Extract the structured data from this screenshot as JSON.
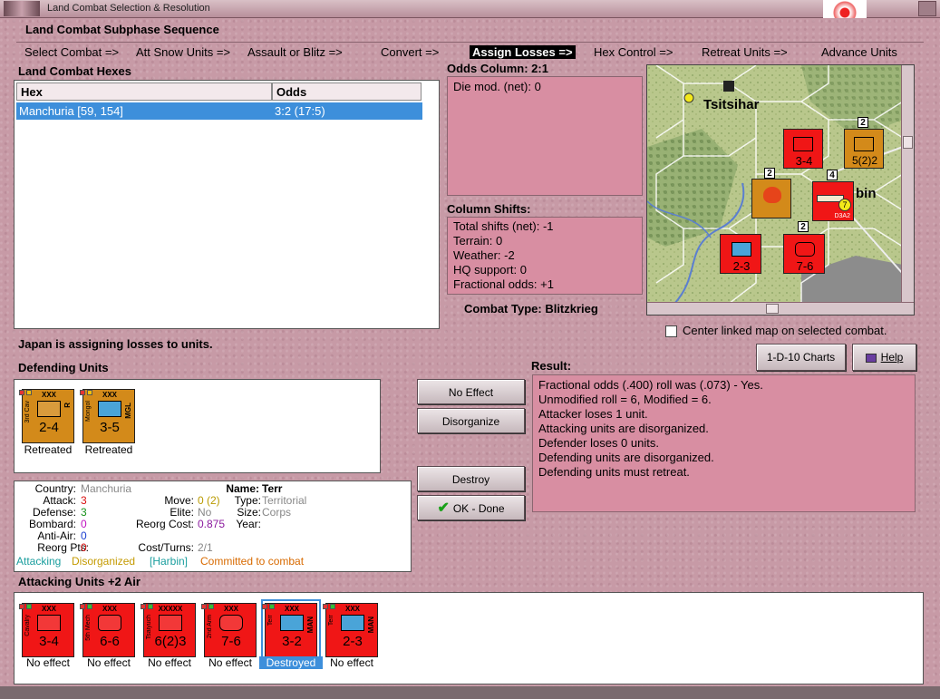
{
  "window": {
    "title": "Land Combat Selection & Resolution"
  },
  "subphase": {
    "header": "Land Combat Subphase Sequence",
    "steps": [
      "Select Combat =>",
      "Att Snow Units =>",
      "Assault or Blitz =>",
      "Convert =>",
      "Assign Losses =>",
      "Hex Control =>",
      "Retreat Units =>",
      "Advance Units"
    ]
  },
  "hexes": {
    "title": "Land Combat Hexes",
    "columns": [
      "Hex",
      "Odds"
    ],
    "rows": [
      {
        "hex": "Manchuria [59, 154]",
        "odds": "3:2 (17:5)"
      }
    ]
  },
  "odds": {
    "title": "Odds Column: 2:1",
    "lines": [
      "Die mod. (net): 0"
    ]
  },
  "shifts": {
    "title": "Column Shifts:",
    "lines": [
      "Total shifts (net): -1",
      "Terrain: 0",
      "Weather: -2",
      "HQ support: 0",
      "Fractional odds: +1"
    ]
  },
  "combat_type": "Combat Type:  Blitzkrieg",
  "map": {
    "city": "Tsitsihar",
    "partial_label": "bin",
    "units": [
      {
        "strength": "3-4",
        "color": "#f01616"
      },
      {
        "strength": "5(2)2",
        "color": "#d38a1a"
      },
      {
        "strength": "2-3",
        "color": "#f01616"
      },
      {
        "strength": "7-6",
        "color": "#f01616"
      }
    ],
    "stack_numbers": [
      "2",
      "2",
      "4",
      "2"
    ],
    "air_badge": "7",
    "air_unit": "D3A2"
  },
  "center_linked": "Center linked map on selected combat.",
  "buttons": {
    "charts": "1-D-10 Charts",
    "help": "Help",
    "no_effect": "No Effect",
    "disorganize": "Disorganize",
    "destroy": "Destroy",
    "ok_done": "OK - Done"
  },
  "assign_message": "Japan is assigning losses to units.",
  "defending": {
    "title": "Defending Units",
    "units": [
      {
        "size": "XXX",
        "side": "3rd Cav",
        "corner": "R",
        "strength": "2-4",
        "status": "Retreated"
      },
      {
        "size": "XXX",
        "side": "Mongol",
        "corner": "MGL",
        "strength": "3-5",
        "status": "Retreated"
      }
    ]
  },
  "info": {
    "country_label": "Country:",
    "country": "Manchuria",
    "attack_label": "Attack:",
    "attack": "3",
    "defense_label": "Defense:",
    "defense": "3",
    "bombard_label": "Bombard:",
    "bombard": "0",
    "antiair_label": "Anti-Air:",
    "antiair": "0",
    "reorgpts_label": "Reorg Pts:",
    "reorgpts": "0",
    "name_label": "Name:",
    "name": "Terr",
    "move_label": "Move:",
    "move": "0 (2)",
    "type_label": "Type:",
    "type": "Territorial",
    "elite_label": "Elite:",
    "elite": "No",
    "size_label": "Size:",
    "size": "Corps",
    "reorgcost_label": "Reorg Cost:",
    "reorgcost": "0.875",
    "year_label": "Year:",
    "costturns_label": "Cost/Turns:",
    "costturns": "2/1",
    "status_attacking": "Attacking",
    "status_disorganized": "Disorganized",
    "status_location": "[Harbin]",
    "status_committed": "Committed to combat"
  },
  "result": {
    "title": "Result:",
    "lines": [
      "Fractional odds (.400) roll was (.073)  - Yes.",
      "Unmodified roll = 6, Modified = 6.",
      "Attacker loses 1 unit.",
      "Attacking units are disorganized.",
      "Defender loses 0 units.",
      "Defending units are disorganized.",
      "Defending units must retreat."
    ]
  },
  "attacking": {
    "title": "Attacking Units +2 Air",
    "units": [
      {
        "size": "XXX",
        "side": "Cavalry",
        "corner": "",
        "strength": "3-4",
        "status": "No effect"
      },
      {
        "size": "XXX",
        "side": "5th Mech",
        "corner": "",
        "strength": "6-6",
        "status": "No effect"
      },
      {
        "size": "XXXXX",
        "side": "Tsaiyuch",
        "corner": "",
        "strength": "6(2)3",
        "status": "No effect"
      },
      {
        "size": "XXX",
        "side": "2nd Arm",
        "corner": "",
        "strength": "7-6",
        "status": "No effect"
      },
      {
        "size": "XXX",
        "side": "Terr",
        "corner": "MAN",
        "strength": "3-2",
        "status": "Destroyed"
      },
      {
        "size": "XXX",
        "side": "Terr",
        "corner": "MAN",
        "strength": "2-3",
        "status": "No effect"
      }
    ]
  },
  "colors": {
    "accent": "#3d8fdb",
    "panel_pink": "#d88ea2",
    "unit_red": "#f01616",
    "unit_orange": "#d38a1a"
  }
}
